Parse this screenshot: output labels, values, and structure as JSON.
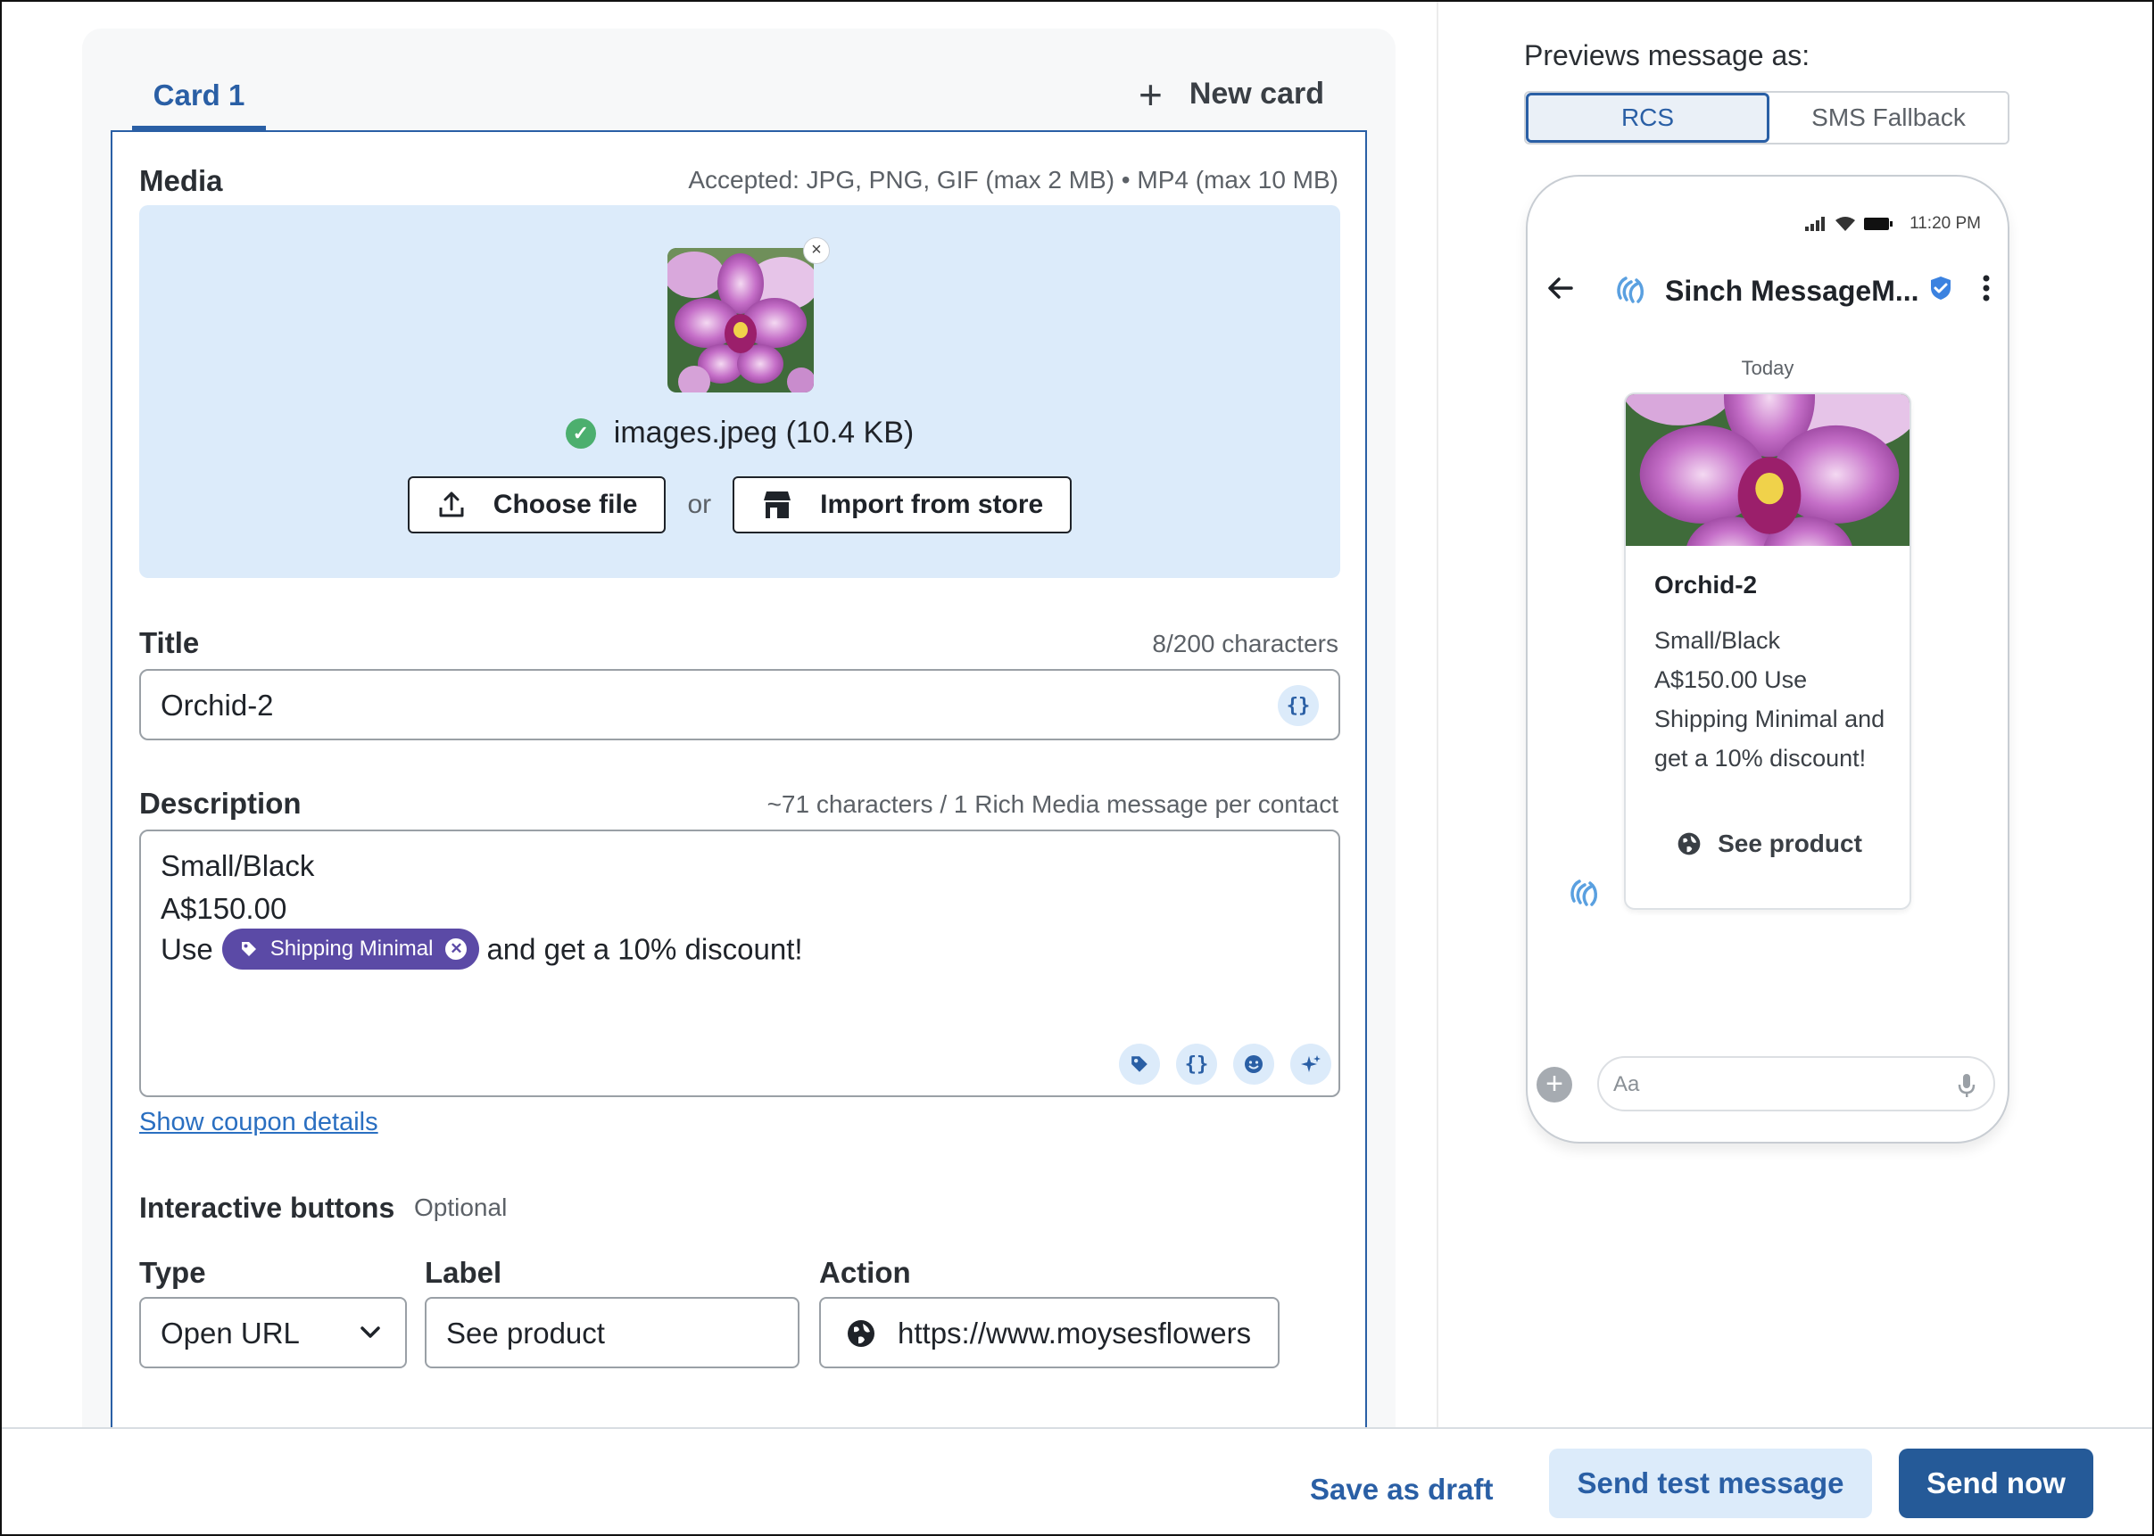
{
  "tabs": {
    "active": "Card 1",
    "new_card": "New card"
  },
  "media": {
    "label": "Media",
    "accepted": "Accepted: JPG, PNG, GIF (max 2 MB) • MP4 (max 10 MB)",
    "file_name": "images.jpeg (10.4 KB)",
    "remove_glyph": "×",
    "choose_file": "Choose file",
    "or": "or",
    "import_store": "Import from store"
  },
  "title_field": {
    "label": "Title",
    "counter": "8/200 characters",
    "value": "Orchid-2"
  },
  "description": {
    "label": "Description",
    "counter": "~71 characters / 1 Rich Media message per contact",
    "line1": "Small/Black",
    "line2": "A$150.00",
    "line3_prefix": "Use",
    "tag": "Shipping Minimal",
    "line3_suffix": "and get a 10% discount!"
  },
  "show_coupon": "Show coupon details",
  "interactive": {
    "label": "Interactive buttons",
    "optional": "Optional",
    "type_label": "Type",
    "type_value": "Open URL",
    "label_label": "Label",
    "label_value": "See product",
    "action_label": "Action",
    "action_value": "https://www.moysesflowers"
  },
  "preview": {
    "heading": "Previews message as:",
    "seg_rcs": "RCS",
    "seg_sms": "SMS Fallback",
    "time": "11:20 PM",
    "sender": "Sinch MessageM...",
    "today": "Today",
    "card_title": "Orchid-2",
    "card_desc": "Small/Black A$150.00 Use Shipping Minimal and get a 10% discount!",
    "card_action": "See product",
    "compose_placeholder": "Aa"
  },
  "footer": {
    "save_draft": "Save as draft",
    "send_test": "Send test message",
    "send_now": "Send now"
  },
  "colors": {
    "accent": "#2a5fa5",
    "dropzone": "#dcebfa",
    "tag_chip": "#5b4aa6",
    "success": "#4caf6e"
  }
}
